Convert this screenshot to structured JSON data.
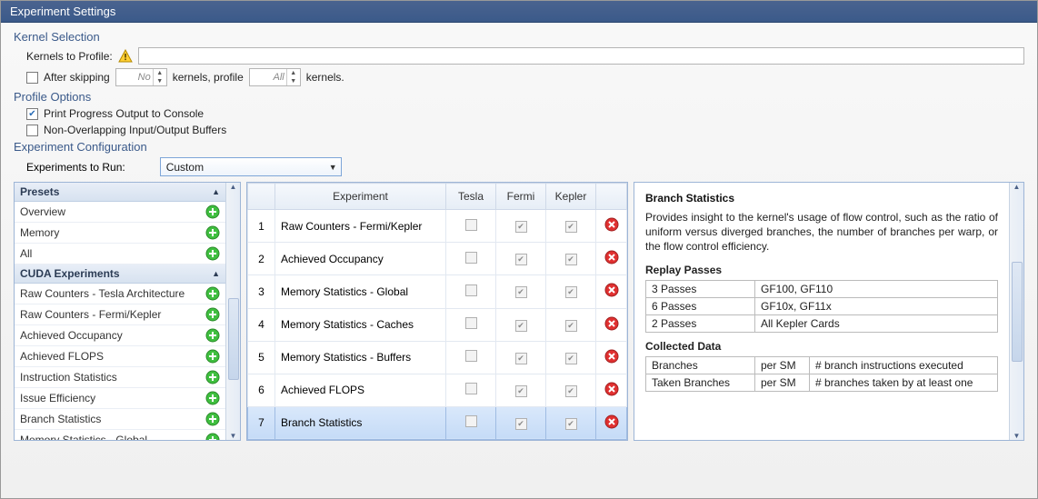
{
  "title": "Experiment Settings",
  "kernel_selection": {
    "heading": "Kernel Selection",
    "kernels_to_profile_label": "Kernels to Profile:",
    "kernels_to_profile_value": "",
    "after_skipping_label": "After skipping",
    "after_skipping_value": "No",
    "kernels_profile_label_mid": "kernels, profile",
    "kernels_profile_value": "All",
    "kernels_profile_label_end": "kernels."
  },
  "profile_options": {
    "heading": "Profile Options",
    "print_progress": "Print Progress Output to Console",
    "non_overlapping": "Non-Overlapping Input/Output Buffers"
  },
  "exp_config": {
    "heading": "Experiment Configuration",
    "experiments_to_run_label": "Experiments to Run:",
    "experiments_to_run_value": "Custom"
  },
  "presets": {
    "header": "Presets",
    "items": [
      "Overview",
      "Memory",
      "All"
    ]
  },
  "cuda_experiments": {
    "header": "CUDA Experiments",
    "items": [
      "Raw Counters - Tesla Architecture",
      "Raw Counters - Fermi/Kepler",
      "Achieved Occupancy",
      "Achieved FLOPS",
      "Instruction Statistics",
      "Issue Efficiency",
      "Branch Statistics",
      "Memory Statistics - Global"
    ]
  },
  "grid": {
    "columns": [
      "",
      "Experiment",
      "Tesla",
      "Fermi",
      "Kepler",
      ""
    ],
    "rows": [
      {
        "n": "1",
        "exp": "Raw Counters - Fermi/Kepler",
        "tesla": false,
        "fermi": true,
        "kepler": true
      },
      {
        "n": "2",
        "exp": "Achieved Occupancy",
        "tesla": false,
        "fermi": true,
        "kepler": true
      },
      {
        "n": "3",
        "exp": "Memory Statistics - Global",
        "tesla": false,
        "fermi": true,
        "kepler": true
      },
      {
        "n": "4",
        "exp": "Memory Statistics - Caches",
        "tesla": false,
        "fermi": true,
        "kepler": true
      },
      {
        "n": "5",
        "exp": "Memory Statistics - Buffers",
        "tesla": false,
        "fermi": true,
        "kepler": true
      },
      {
        "n": "6",
        "exp": "Achieved FLOPS",
        "tesla": false,
        "fermi": true,
        "kepler": true
      },
      {
        "n": "7",
        "exp": "Branch Statistics",
        "tesla": false,
        "fermi": true,
        "kepler": true
      }
    ],
    "selected_index": 6
  },
  "details": {
    "title": "Branch Statistics",
    "desc": "Provides insight to the kernel's usage of flow control, such as the ratio of uniform versus diverged branches, the number of branches per warp, or the flow control efficiency.",
    "replay_heading": "Replay Passes",
    "replay_rows": [
      {
        "passes": "3 Passes",
        "cards": "GF100, GF110"
      },
      {
        "passes": "6 Passes",
        "cards": "GF10x, GF11x"
      },
      {
        "passes": "2 Passes",
        "cards": "All Kepler Cards"
      }
    ],
    "collected_heading": "Collected Data",
    "collected_rows": [
      {
        "name": "Branches",
        "scope": "per SM",
        "desc": "# branch instructions executed"
      },
      {
        "name": "Taken Branches",
        "scope": "per SM",
        "desc": "# branches taken by at least one"
      }
    ]
  }
}
